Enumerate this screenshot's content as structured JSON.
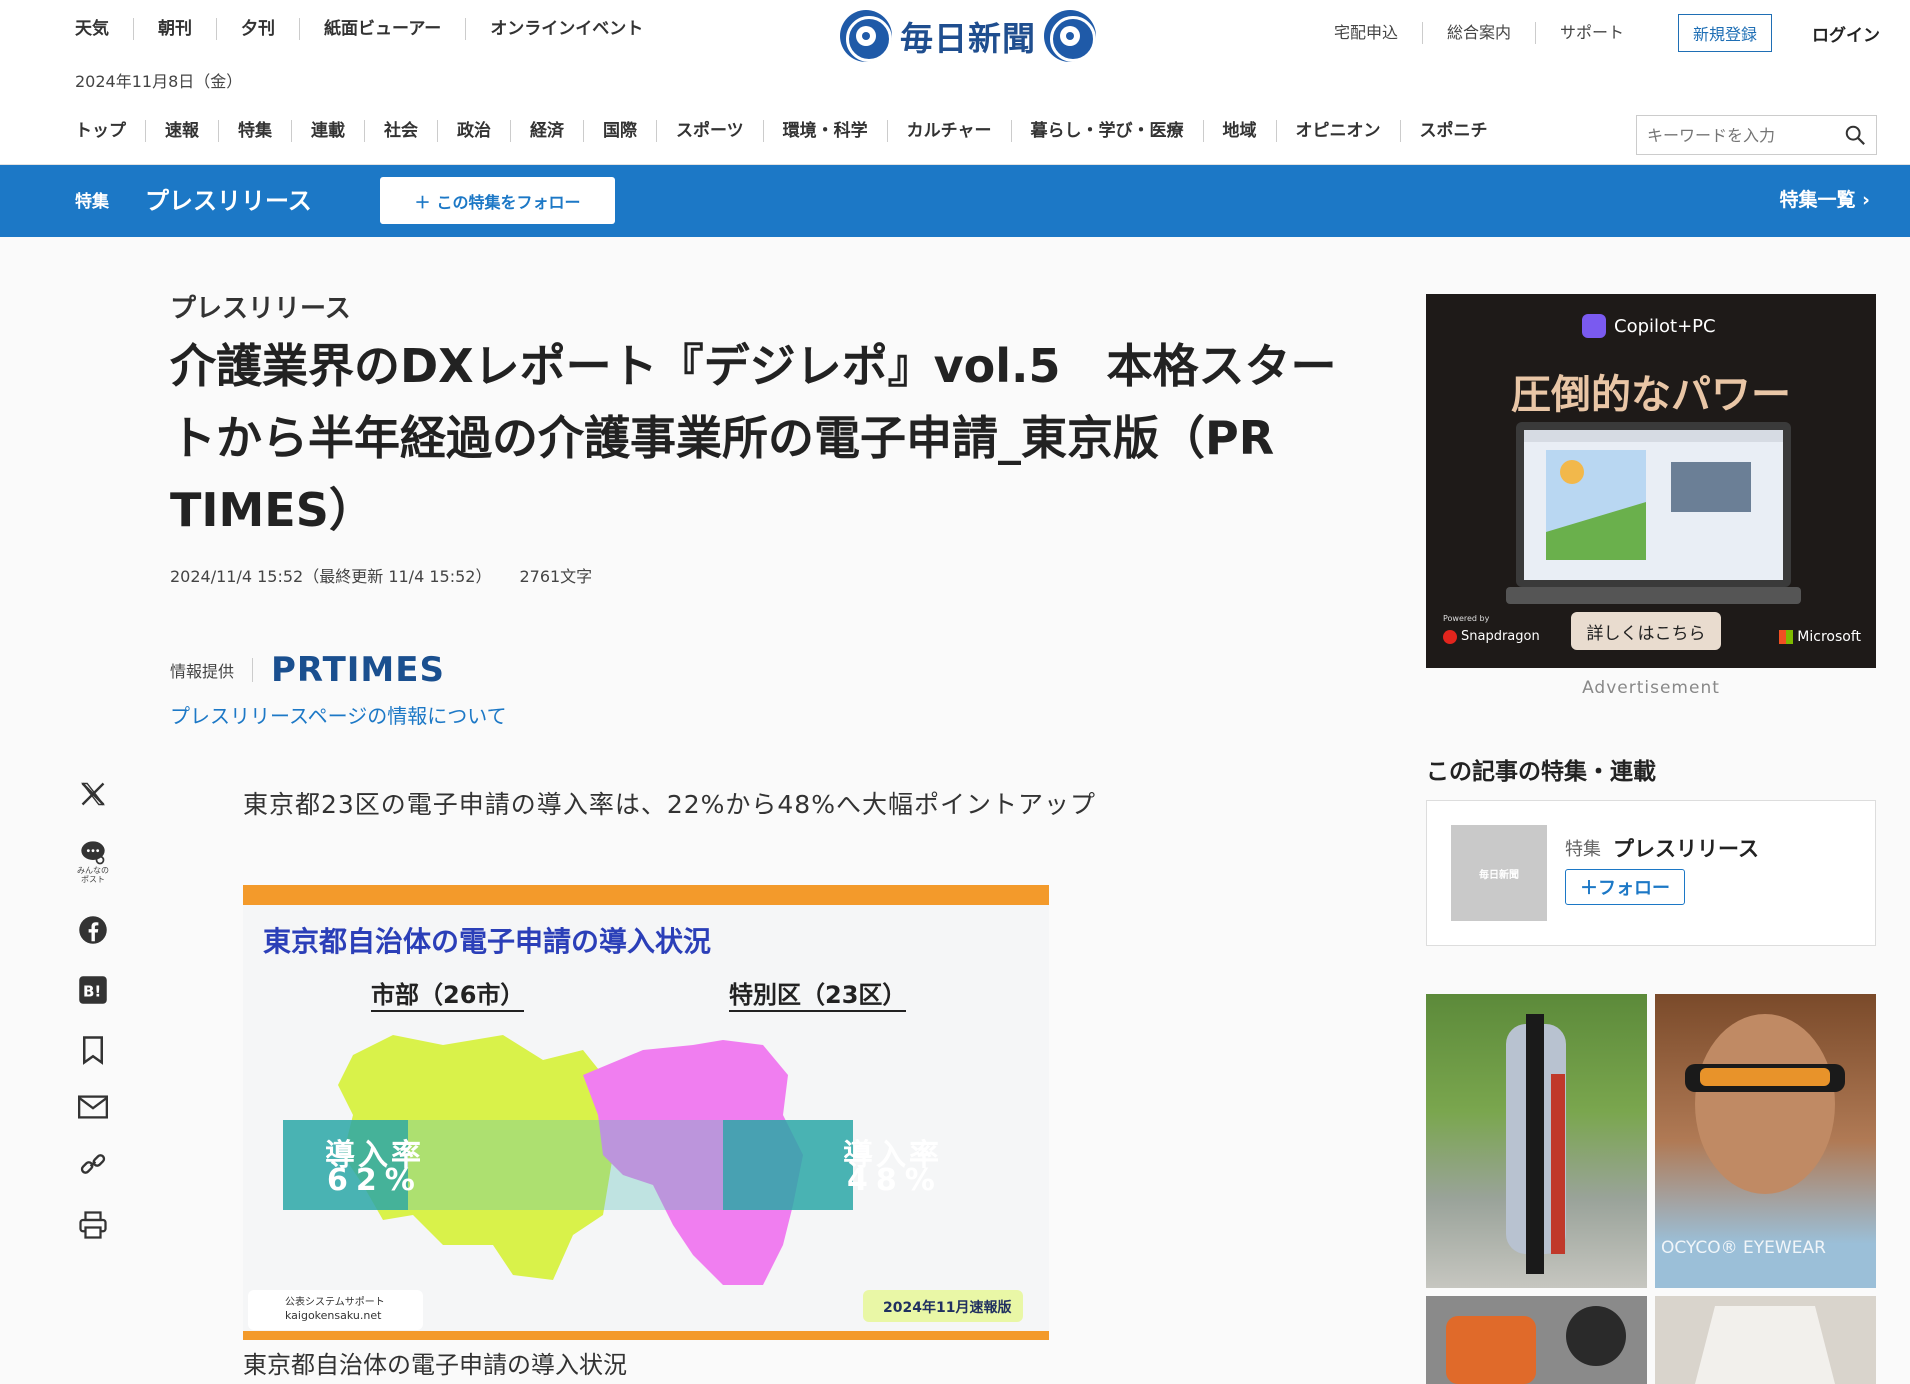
{
  "header": {
    "top_links": [
      "天気",
      "朝刊",
      "夕刊",
      "紙面ビューアー",
      "オンラインイベント"
    ],
    "date": "2024年11月8日（金）",
    "logo": "毎日新聞",
    "right_links": [
      "宅配申込",
      "総合案内",
      "サポート"
    ],
    "register": "新規登録",
    "login": "ログイン",
    "nav": [
      "トップ",
      "速報",
      "特集",
      "連載",
      "社会",
      "政治",
      "経済",
      "国際",
      "スポーツ",
      "環境・科学",
      "カルチャー",
      "暮らし・学び・医療",
      "地域",
      "オピニオン",
      "スポニチ"
    ],
    "search_placeholder": "キーワードを入力"
  },
  "feature_bar": {
    "kind": "特集",
    "title": "プレスリリース",
    "follow": "この特集をフォロー",
    "list": "特集一覧"
  },
  "article": {
    "category": "プレスリリース",
    "title": "介護業界のDXレポート『デジレポ』vol.5　本格スタートから半年経過の介護事業所の電子申請_東京版（PR TIMES）",
    "published": "2024/11/4 15:52（最終更新 11/4 15:52）",
    "chars": "2761文字",
    "provider_label": "情報提供",
    "provider": "PRTIMES",
    "info_link": "プレスリリースページの情報について",
    "lead": "東京都23区の電子申請の導入率は、22%から48%へ大幅ポイントアップ",
    "figure": {
      "heading": "東京都自治体の電子申請の導入状況",
      "left_label": "市部（26市）",
      "right_label": "特別区（23区）",
      "left_rate_label": "導入率",
      "left_rate": "62%",
      "right_rate_label": "導入率",
      "right_rate": "48%",
      "brand_jp": "公表システムサポート",
      "brand_url": "kaigokensaku.net",
      "badge": "2024年11月速報版"
    },
    "caption": "東京都自治体の電子申請の導入状況"
  },
  "share": {
    "community_label": "みんなの\nポスト"
  },
  "ad": {
    "brand": "Copilot+PC",
    "headline": "圧倒的なパワー",
    "cta": "詳しくはこちら",
    "powered": "Powered by",
    "partner1": "Snapdragon",
    "partner2": "Microsoft",
    "label": "Advertisement"
  },
  "sidebar": {
    "section_title": "この記事の特集・連載",
    "card": {
      "thumb": "毎日新聞",
      "kind": "特集",
      "title": "プレスリリース",
      "follow": "フォロー"
    },
    "tile_text": "OCYCO® EYEWEAR"
  },
  "colors": {
    "brand_blue": "#1c78c6",
    "logo_blue": "#1f5aa8"
  }
}
